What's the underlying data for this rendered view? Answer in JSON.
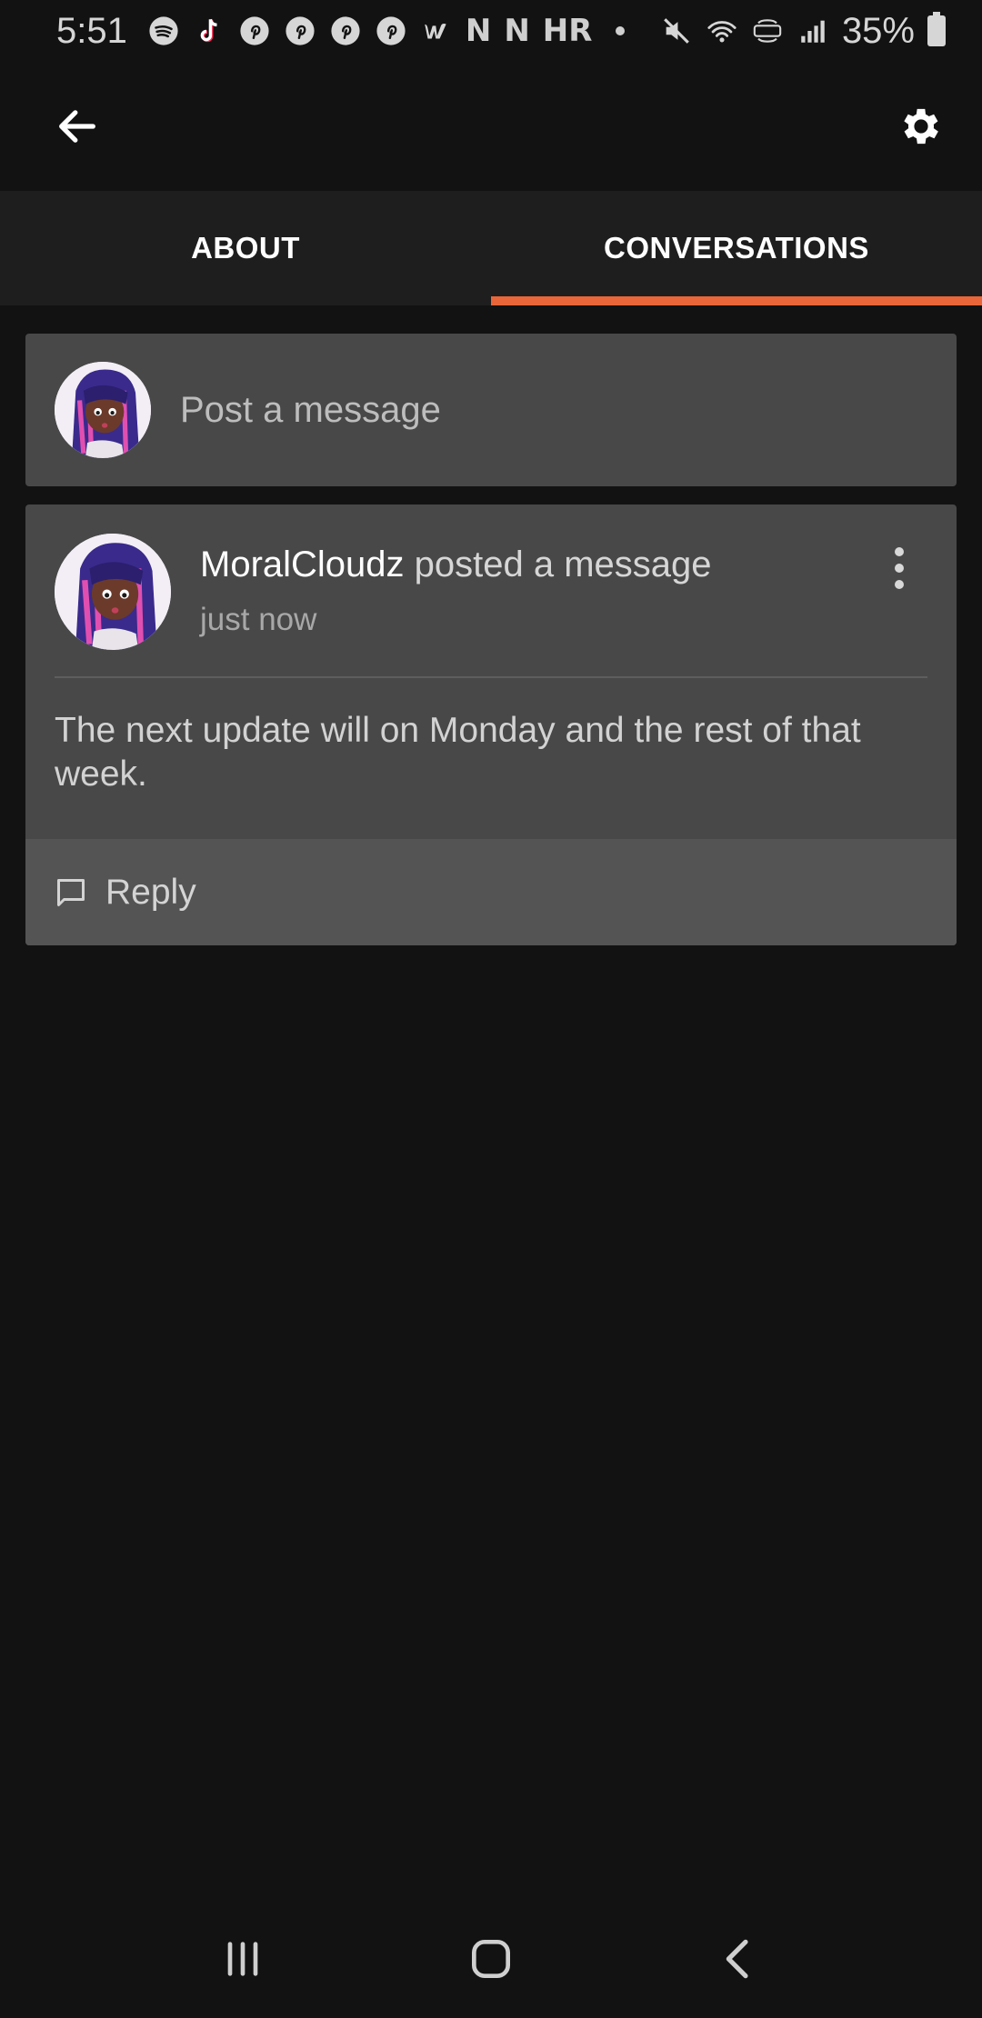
{
  "status_bar": {
    "time": "5:51",
    "notification_icons": [
      "spotify-icon",
      "tiktok-icon",
      "pinterest-icon",
      "pinterest-icon",
      "pinterest-icon",
      "pinterest-icon",
      "wattpad-icon",
      "netflix-icon",
      "netflix-icon",
      "hr-icon",
      "more-dot-icon"
    ],
    "letter_n": "N",
    "letter_hr": "HR",
    "battery_percent": "35%",
    "system_icons": [
      "mute-icon",
      "wifi-icon",
      "volte-icon",
      "signal-icon",
      "battery-icon"
    ]
  },
  "toolbar": {
    "back_icon": "back-arrow-icon",
    "settings_icon": "gear-icon"
  },
  "tabs": [
    {
      "label": "ABOUT",
      "active": false
    },
    {
      "label": "CONVERSATIONS",
      "active": true
    }
  ],
  "composer": {
    "placeholder": "Post a message"
  },
  "post": {
    "author": "MoralCloudz",
    "action": "posted a message",
    "timestamp": "just now",
    "body": "The next update will on Monday and the rest of that week.",
    "reply_label": "Reply"
  },
  "nav_bar": {
    "buttons": [
      "recent-apps-icon",
      "home-icon",
      "back-icon"
    ]
  },
  "colors": {
    "background": "#121212",
    "tab_bar": "#1e1e1e",
    "accent": "#e8663a",
    "card": "#484848",
    "card_footer": "#545454"
  }
}
